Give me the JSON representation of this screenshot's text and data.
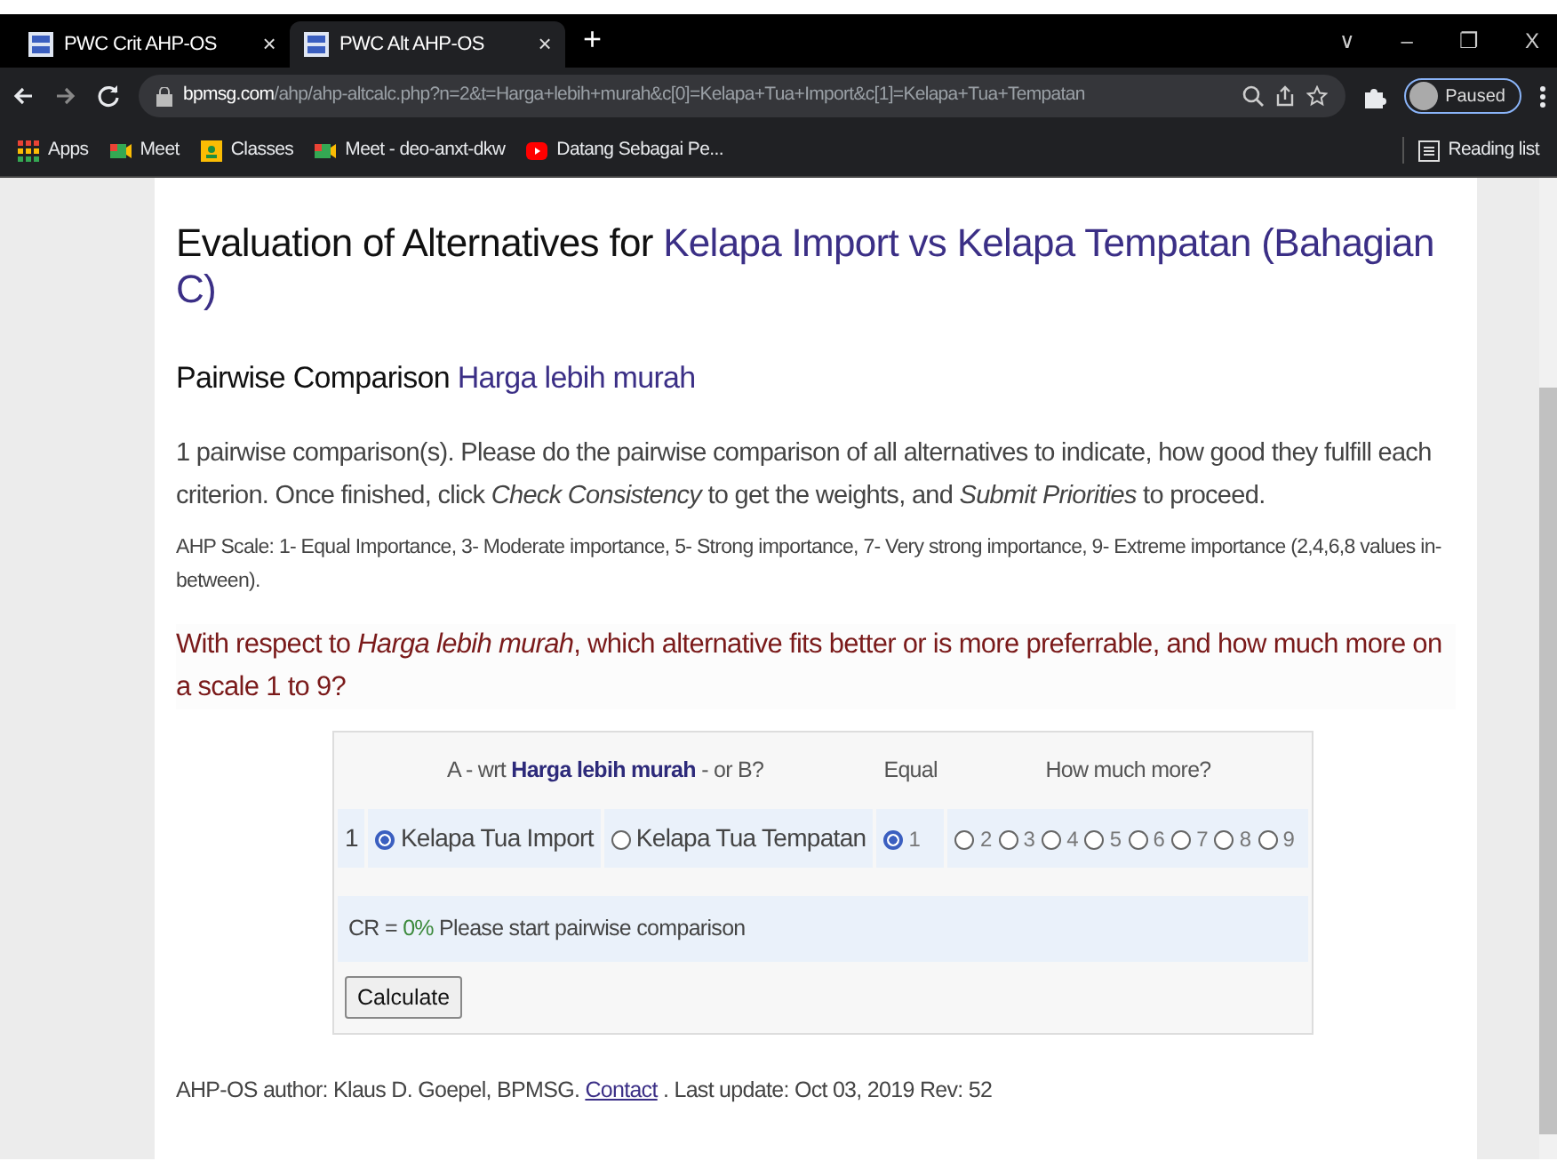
{
  "browser": {
    "tabs": [
      {
        "label": "PWC Crit AHP-OS",
        "close": "×",
        "selected": false
      },
      {
        "label": "PWC Alt AHP-OS",
        "close": "×",
        "selected": true
      }
    ],
    "new_tab": "+",
    "window_controls": [
      "∨",
      "–",
      "❐",
      "X"
    ],
    "url": {
      "domain": "bpmsg.com",
      "path": "/ahp/ahp-altcalc.php?n=2&t=Harga+lebih+murah&c[0]=Kelapa+Tua+Import&c[1]=Kelapa+Tua+Tempatan"
    },
    "profile": "Paused",
    "bookmarks": [
      {
        "label": "Apps",
        "kind": "apps"
      },
      {
        "label": "Meet",
        "kind": "meet"
      },
      {
        "label": "Classes",
        "kind": "classes"
      },
      {
        "label": "Meet - deo-anxt-dkw",
        "kind": "meet"
      },
      {
        "label": "Datang Sebagai Pe...",
        "kind": "video"
      }
    ],
    "reading_list": "Reading list"
  },
  "page": {
    "title": {
      "text": "Evaluation of Alternatives for ",
      "highlight": "Kelapa Import vs Kelapa Tempatan (Bahagian C)"
    },
    "subtitle": {
      "text": "Pairwise Comparison ",
      "highlight": "Harga lebih murah"
    },
    "intro": "1 pairwise comparison(s). Please do the pairwise comparison of all alternatives to indicate, how good they fulfill each criterion. Once finished, click *Check Consistency* to get the weights, and *Submit Priorities* to proceed.",
    "scale_note": "AHP Scale: 1- Equal Importance, 3- Moderate importance, 5- Strong importance, 7- Very strong importance, 9- Extreme importance (2,4,6,8 values in-between).",
    "question": "With respect to *Harga lebih murah*, which alternative fits better or is more preferrable, and how much more on a scale 1 to 9?",
    "table": {
      "header": {
        "ab_prefix": "A - wrt ",
        "ab_highlight": "Harga lebih murah",
        "ab_suffix": " - or B?",
        "equal": "Equal",
        "more": "How much more?"
      },
      "rows": [
        {
          "number": "1",
          "a": {
            "label": "Kelapa Tua Import",
            "selected": true
          },
          "b": {
            "label": "Kelapa Tua Tempatan",
            "selected": false
          },
          "scale": [
            {
              "label": "1",
              "selected": true
            },
            {
              "label": "2",
              "selected": false
            },
            {
              "label": "3",
              "selected": false
            },
            {
              "label": "4",
              "selected": false
            },
            {
              "label": "5",
              "selected": false
            },
            {
              "label": "6",
              "selected": false
            },
            {
              "label": "7",
              "selected": false
            },
            {
              "label": "8",
              "selected": false
            },
            {
              "label": "9",
              "selected": false
            }
          ]
        }
      ],
      "cr_label": "CR = ",
      "cr_value": "0%",
      "cr_message": " Please start pairwise comparison",
      "button": "Calculate"
    },
    "footer": {
      "before": "AHP-OS author: Klaus D. Goepel, BPMSG. ",
      "link": "Contact",
      "after": " . Last update: Oct 03, 2019 Rev: 52"
    }
  }
}
